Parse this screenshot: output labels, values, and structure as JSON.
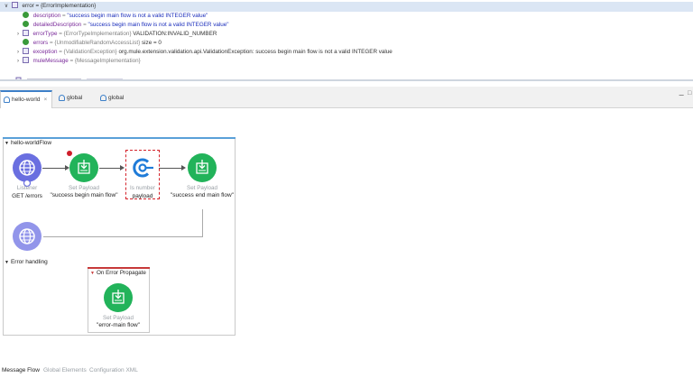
{
  "variables": {
    "root": {
      "name": "error",
      "type": "{ErrorImplementation}"
    },
    "rows": [
      {
        "kind": "string",
        "name": "description",
        "value": "\"success begin main flow is not a valid INTEGER value\""
      },
      {
        "kind": "string",
        "name": "detailedDescription",
        "value": "\"success begin main flow is not a valid INTEGER value\""
      },
      {
        "kind": "object",
        "name": "errorType",
        "type": "{ErrorTypeImplementation}",
        "value": "VALIDATION:INVALID_NUMBER"
      },
      {
        "kind": "string",
        "name": "errors",
        "type": "{UnmodifiableRandomAccessList}",
        "value": "size = 0"
      },
      {
        "kind": "object",
        "name": "exception",
        "type": "{ValidationException}",
        "value": "org.mule.extension.validation.api.ValidationException: success begin main flow is not a valid INTEGER value"
      },
      {
        "kind": "object",
        "name": "muleMessage",
        "type": "{MessageImplementation}",
        "value": ""
      }
    ]
  },
  "tabs": [
    {
      "label": "hello-world",
      "active": true
    },
    {
      "label": "global",
      "active": false
    },
    {
      "label": "global",
      "active": false
    }
  ],
  "flow": {
    "title": "hello-worldFlow",
    "components": [
      {
        "type": "Listener",
        "value": "GET /errors"
      },
      {
        "type": "Set Payload",
        "value": "\"success begin main flow\""
      },
      {
        "type": "Is number",
        "value": "payload"
      },
      {
        "type": "Set Payload",
        "value": "\"success end main flow\""
      }
    ],
    "error_handling_title": "Error handling",
    "on_error": {
      "title": "On Error Propagate",
      "component": {
        "type": "Set Payload",
        "value": "\"error-main flow\""
      }
    }
  },
  "bottom_tabs": [
    "Message Flow",
    "Global Elements",
    "Configuration XML"
  ],
  "colors": {
    "listener": "#6a6fe0",
    "set_payload": "#22b35a",
    "validation": "#1f7bd8",
    "error_marker": "#cf1e2b",
    "selection": "#d4222a"
  }
}
